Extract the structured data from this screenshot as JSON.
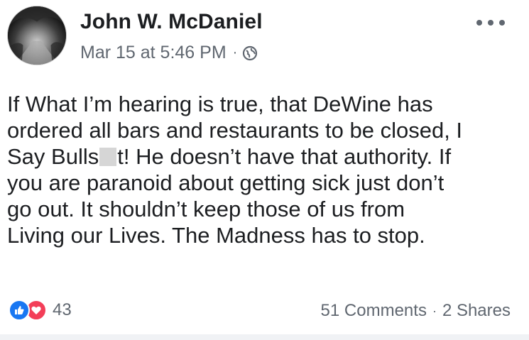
{
  "post": {
    "author": "John W. McDaniel",
    "date": "Mar 15 at 5:46 PM",
    "separator": "·",
    "privacy_icon": "globe-icon",
    "menu_icon": "more-horizontal-icon",
    "lines": [
      "If What I’m hearing is true, that DeWine has",
      "ordered all bars and restaurants to be closed, I",
      "you are paranoid about getting sick just don’t",
      "go out. It shouldn’t keep those of us from",
      "Living our Lives. The Madness has to stop."
    ],
    "line3_before": "Say Bulls",
    "line3_after": "t! He doesn’t have that authority. If"
  },
  "footer": {
    "reaction_icons": [
      "like-reaction-icon",
      "love-reaction-icon"
    ],
    "reaction_count": "43",
    "comments": "51 Comments",
    "dot": "·",
    "shares": "2 Shares"
  },
  "colors": {
    "text": "#1c1e21",
    "meta": "#606770",
    "like": "#1877f2",
    "love": "#f33e58"
  }
}
